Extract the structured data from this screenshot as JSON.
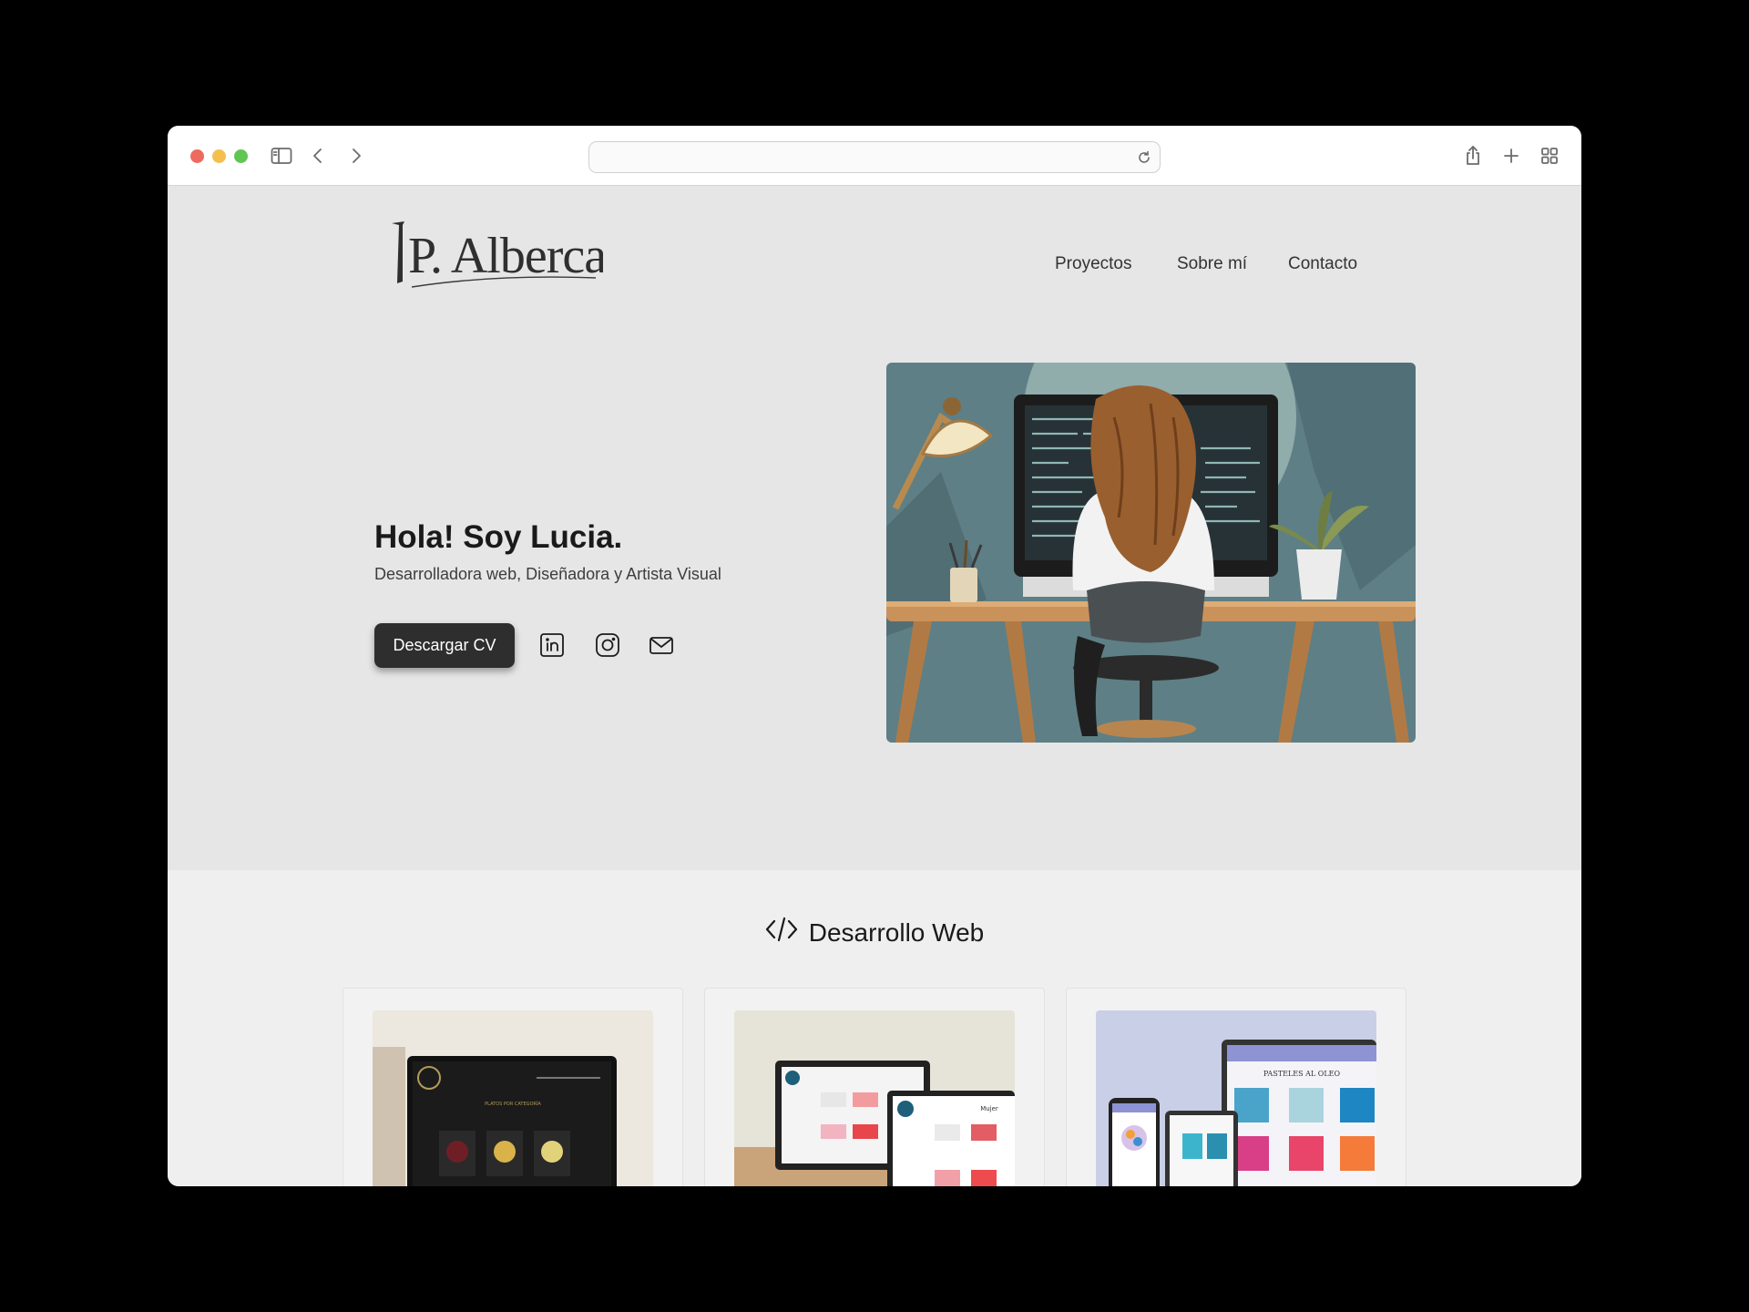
{
  "browser": {
    "address_text": "",
    "traffic_lights": [
      "close",
      "minimize",
      "zoom"
    ],
    "toolbar_icons": [
      "sidebar-icon",
      "back-icon",
      "forward-icon",
      "reload-icon",
      "share-icon",
      "new-tab-icon",
      "tab-overview-icon"
    ]
  },
  "site": {
    "logo_text": "P. Alberca",
    "nav": [
      "Proyectos",
      "Sobre mí",
      "Contacto"
    ],
    "hero": {
      "title": "Hola! Soy Lucia.",
      "subtitle": "Desarrolladora web, Diseñadora y Artista Visual",
      "cv_button": "Descargar CV",
      "social_icons": [
        "linkedin-icon",
        "instagram-icon",
        "mail-icon"
      ]
    },
    "section": {
      "title": "Desarrollo Web",
      "icon": "code-icon"
    },
    "cards": [
      {
        "thumb_heading": "PLATOS POR CATEGORÍA"
      },
      {
        "thumb_heading": "Mujer"
      },
      {
        "thumb_heading": "PASTELES AL OLEO"
      }
    ]
  },
  "colors": {
    "hero_bg": "#e6e6e6",
    "section_bg": "#efefef",
    "button_bg": "#2e2e2e",
    "text": "#1a1a1a"
  }
}
